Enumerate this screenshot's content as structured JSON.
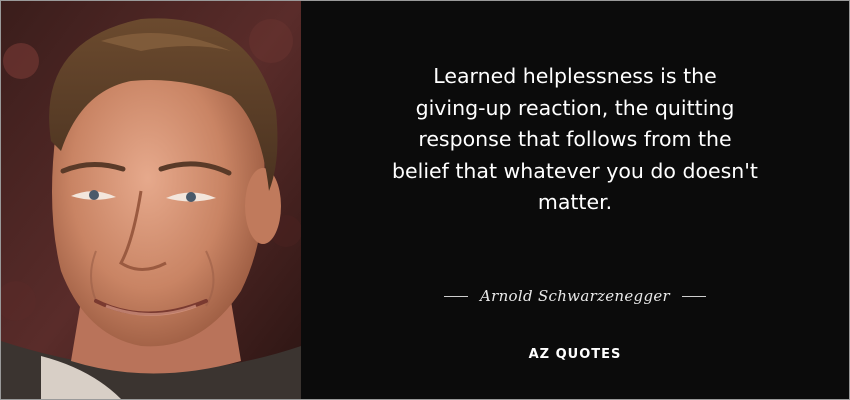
{
  "quote": {
    "lines": [
      "Learned helplessness is the",
      "giving-up reaction, the quitting",
      "response that follows from the",
      "belief that whatever you do doesn't",
      "matter."
    ],
    "author": "Arnold Schwarzenegger"
  },
  "brand": {
    "name": "AZ QUOTES"
  },
  "colors": {
    "background": "#0b0b0b",
    "text": "#ffffff"
  }
}
